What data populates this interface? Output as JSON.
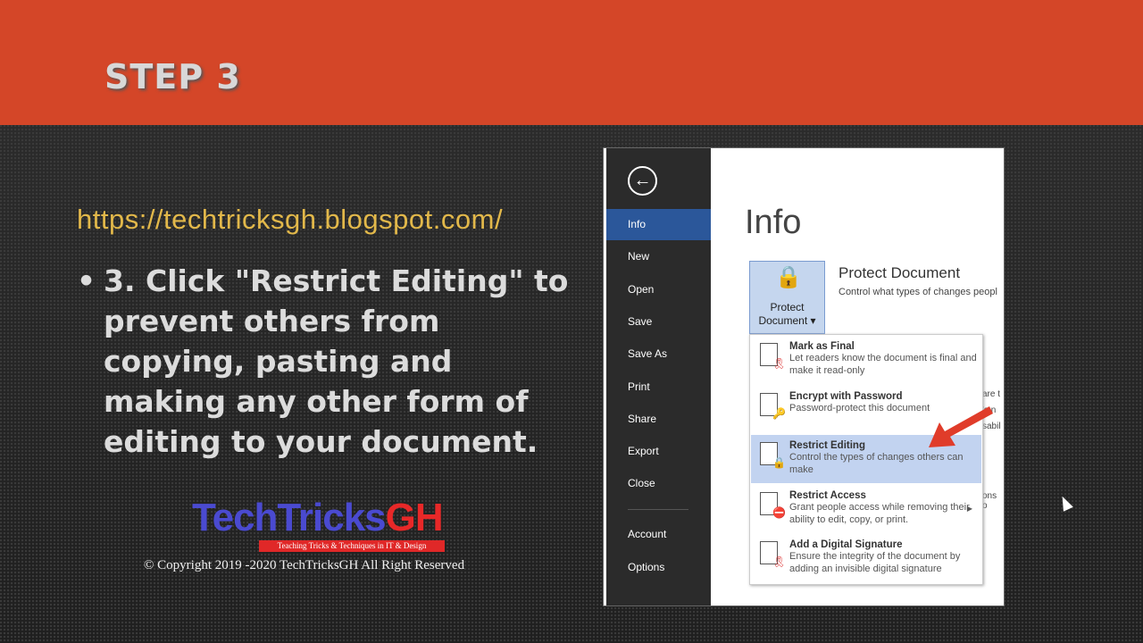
{
  "slide": {
    "step": "STEP 3",
    "url": "https://techtricksgh.blogspot.com/",
    "bullet": "3. Click \"Restrict Editing\" to prevent others from copying, pasting and making any other form of editing to your document.",
    "logo_text_a": "TechTricks",
    "logo_text_b": "GH",
    "tagline": "Teaching Tricks & Techniques in IT & Design",
    "copyright": "© Copyright 2019 -2020 TechTricksGH All Right Reserved"
  },
  "colors": {
    "header": "#d44628",
    "accent": "#2b579a",
    "url": "#e2b84a"
  },
  "word": {
    "nav": [
      "Info",
      "New",
      "Open",
      "Save",
      "Save As",
      "Print",
      "Share",
      "Export",
      "Close",
      "Account",
      "Options"
    ],
    "title": "Info",
    "protect_button": [
      "Protect",
      "Document ▾"
    ],
    "protect_heading": "Protect Document",
    "protect_desc": "Control what types of changes peopl",
    "peek": [
      "are t",
      "'s n",
      "sabil",
      "ons o"
    ],
    "menu": [
      {
        "title": "Mark as Final",
        "desc": "Let readers know the document is final and make it read-only",
        "icon": "ribbon-icon"
      },
      {
        "title": "Encrypt with Password",
        "desc": "Password-protect this document",
        "icon": "lock-key-icon"
      },
      {
        "title": "Restrict Editing",
        "desc": "Control the types of changes others can make",
        "icon": "lock-icon"
      },
      {
        "title": "Restrict Access",
        "desc": "Grant people access while removing their ability to edit, copy, or print.",
        "icon": "no-entry-icon"
      },
      {
        "title": "Add a Digital Signature",
        "desc": "Ensure the integrity of the document by adding an invisible digital signature",
        "icon": "ribbon-icon"
      }
    ]
  }
}
